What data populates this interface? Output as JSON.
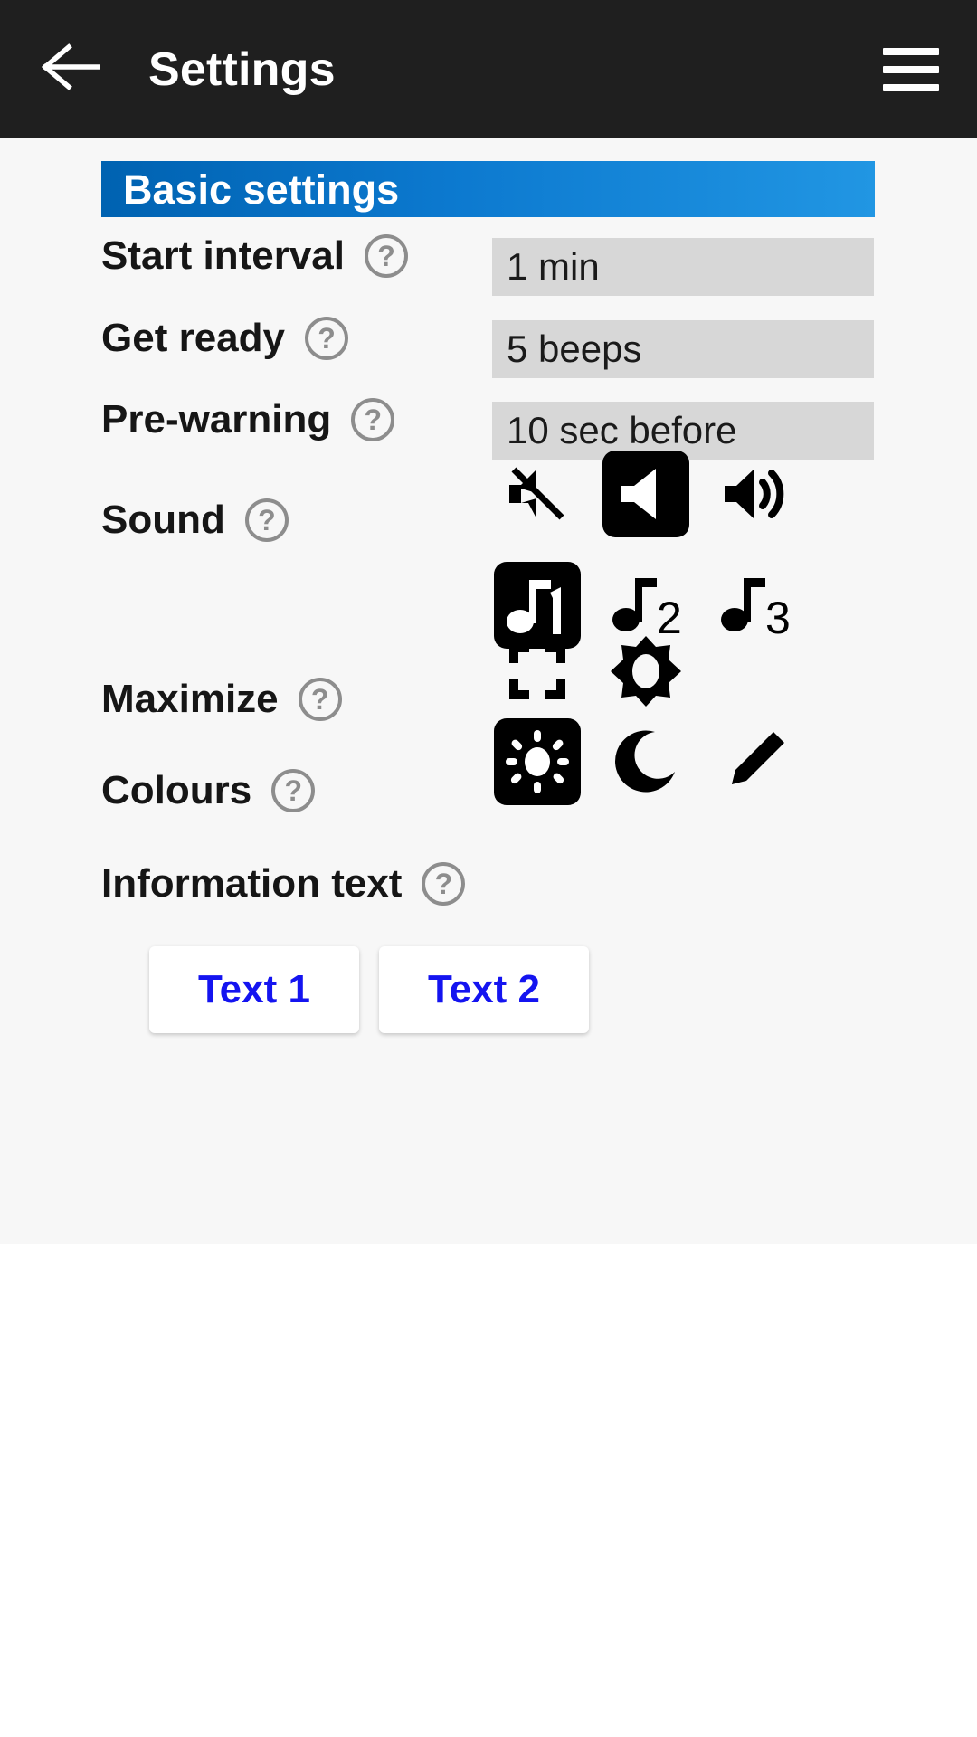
{
  "appbar": {
    "back_icon": "arrow-left-icon",
    "title": "Settings",
    "menu_icon": "hamburger-menu-icon"
  },
  "section": {
    "title": "Basic settings",
    "accent_start": "#0062b1",
    "accent_end": "#2196e3"
  },
  "help_glyph": "?",
  "rows": {
    "start_interval": {
      "label": "Start interval",
      "value": "1 min"
    },
    "get_ready": {
      "label": "Get ready",
      "value": "5 beeps"
    },
    "pre_warning": {
      "label": "Pre-warning",
      "value": "10 sec before"
    },
    "sound": {
      "label": "Sound",
      "options": [
        {
          "name": "sound-mute-icon",
          "selected": false
        },
        {
          "name": "sound-speaker-icon",
          "selected": true
        },
        {
          "name": "sound-volume-high-icon",
          "selected": false
        },
        {
          "name": "music-note-1-icon",
          "label": "1",
          "selected": true
        },
        {
          "name": "music-note-2-icon",
          "label": "2",
          "selected": false
        },
        {
          "name": "music-note-3-icon",
          "label": "3",
          "selected": false
        }
      ]
    },
    "maximize": {
      "label": "Maximize",
      "options": [
        {
          "name": "fullscreen-icon",
          "selected": false
        },
        {
          "name": "brightness-star-icon",
          "selected": false
        }
      ]
    },
    "colours": {
      "label": "Colours",
      "options": [
        {
          "name": "sun-light-theme-icon",
          "selected": true
        },
        {
          "name": "moon-dark-theme-icon",
          "selected": false
        },
        {
          "name": "pencil-custom-theme-icon",
          "selected": false
        }
      ]
    },
    "information_text": {
      "label": "Information text",
      "buttons": [
        {
          "label": "Text 1"
        },
        {
          "label": "Text 2"
        }
      ]
    }
  }
}
